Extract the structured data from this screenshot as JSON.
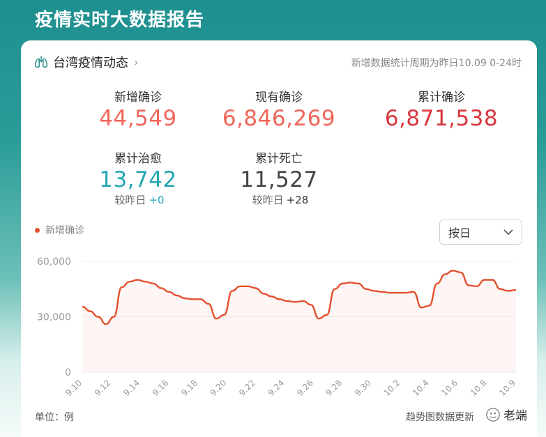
{
  "header": {
    "title": "疫情实时大数据报告"
  },
  "card": {
    "title": "台湾疫情动态",
    "period_note": "新增数据统计周期为昨日10.09 0-24时",
    "icons": {
      "lung": "lung-icon",
      "chevron": "chevron-right-icon"
    }
  },
  "stats": {
    "new_confirmed": {
      "label": "新增确诊",
      "value": "44,549",
      "color": "#f0665a"
    },
    "current_confirmed": {
      "label": "现有确诊",
      "value": "6,846,269",
      "color": "#f0665a"
    },
    "total_confirmed": {
      "label": "累计确诊",
      "value": "6,871,538",
      "color": "#d9363e"
    },
    "total_recovered": {
      "label": "累计治愈",
      "value": "13,742",
      "color": "#23a7b4",
      "compare_label": "较昨日",
      "compare_value": "+0"
    },
    "total_deaths": {
      "label": "累计死亡",
      "value": "11,527",
      "color": "#444444",
      "compare_label": "较昨日",
      "compare_value": "+28"
    }
  },
  "legend": {
    "label": "新增确诊",
    "color": "#e4502f"
  },
  "select": {
    "value": "按日",
    "icon": "chevron-down-icon"
  },
  "footer": {
    "unit": "单位：例",
    "note": "趋势图数据更新",
    "watermark": "老端"
  },
  "chart_data": {
    "type": "line",
    "series": [
      {
        "name": "新增确诊",
        "color": "#e4502f",
        "values": [
          35500,
          33000,
          30000,
          26000,
          30000,
          46000,
          49000,
          50000,
          49000,
          48000,
          45500,
          43500,
          41500,
          40000,
          39500,
          39500,
          37000,
          29000,
          31000,
          44000,
          46500,
          46500,
          45500,
          42500,
          41000,
          39500,
          38500,
          38000,
          38500,
          36500,
          29000,
          31000,
          45000,
          48000,
          48500,
          48000,
          45000,
          44000,
          43500,
          43000,
          43000,
          43000,
          43500,
          35000,
          36000,
          48000,
          53000,
          55000,
          54000,
          47000,
          46500,
          50000,
          50000,
          45000,
          44000,
          44549
        ]
      }
    ],
    "x_ticks": [
      "9.10",
      "9.12",
      "9.14",
      "9.16",
      "9.18",
      "9.20",
      "9.22",
      "9.24",
      "9.26",
      "9.28",
      "9.30",
      "10.2",
      "10.4",
      "10.6",
      "10.8",
      "10.9"
    ],
    "y_ticks": [
      "0",
      "30,000",
      "60,000"
    ],
    "ylim": [
      0,
      60000
    ]
  }
}
